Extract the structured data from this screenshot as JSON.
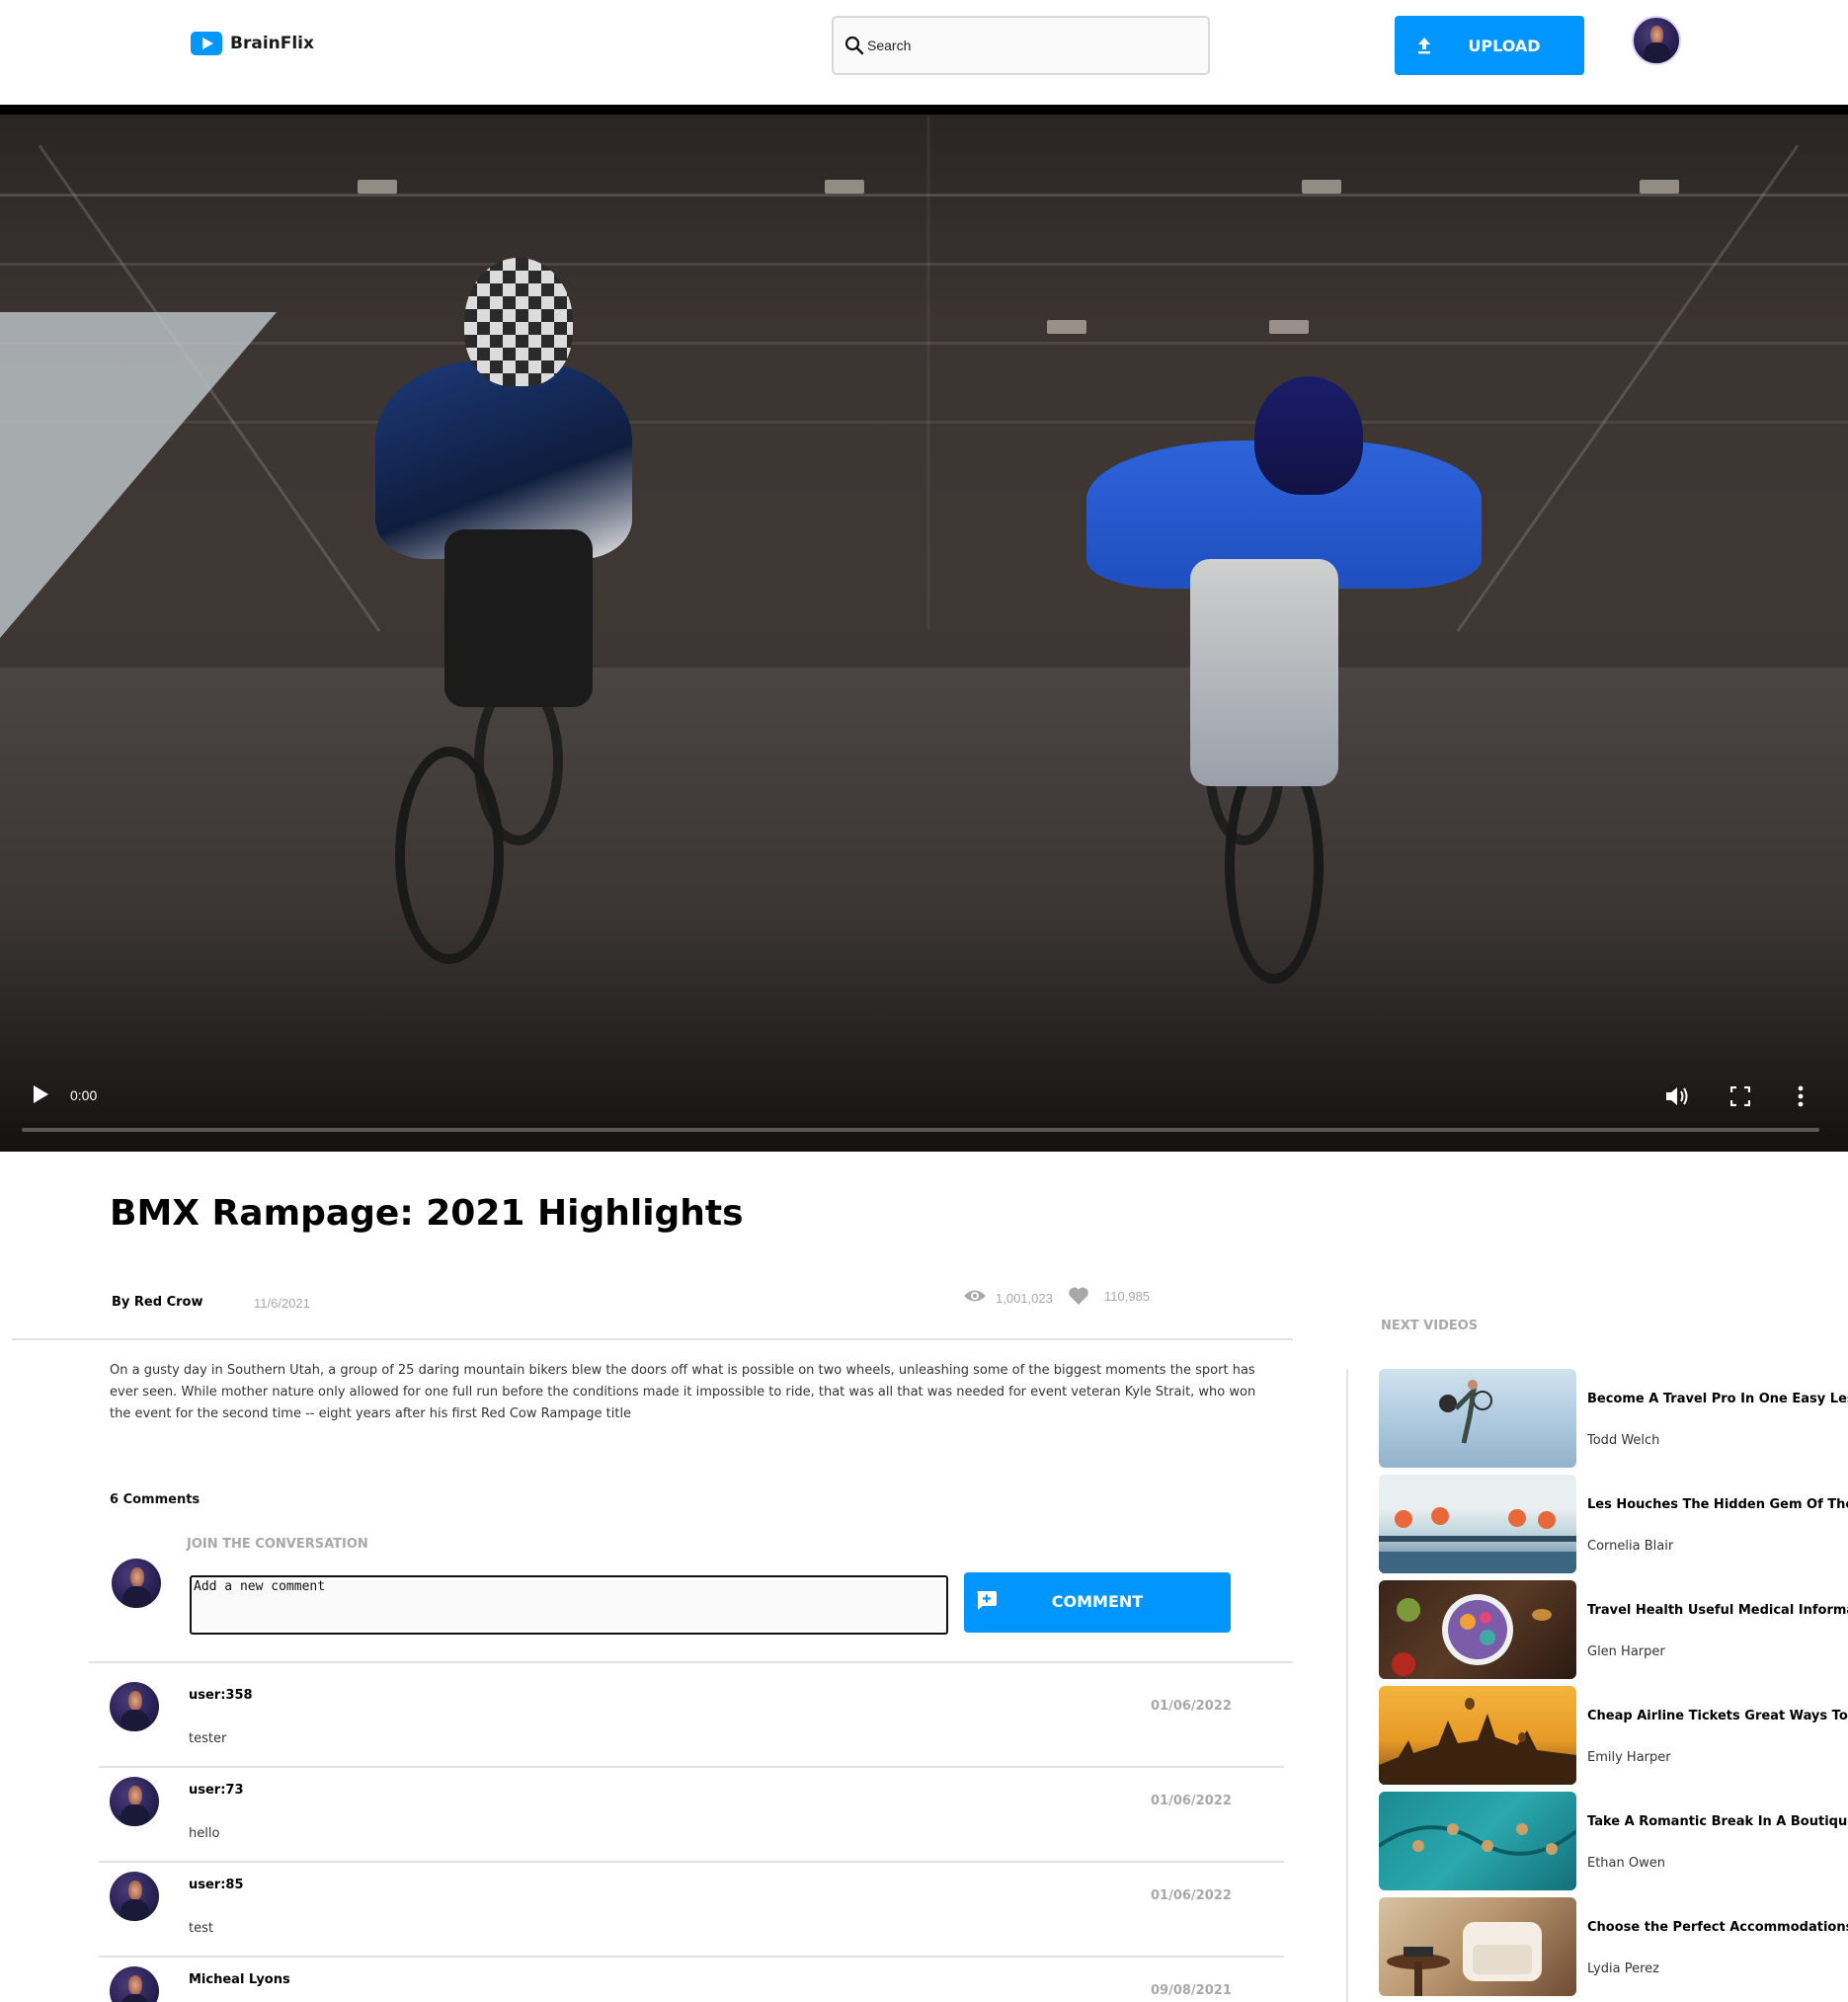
{
  "header": {
    "brand": "BrainFlix",
    "search_placeholder": "Search",
    "upload_label": "UPLOAD"
  },
  "player": {
    "current_time": "0:00",
    "progress": 0
  },
  "video": {
    "title": "BMX Rampage: 2021 Highlights",
    "channel": "By Red Crow",
    "date": "11/6/2021",
    "views": "1,001,023",
    "likes": "110,985",
    "description": "On a gusty day in Southern Utah, a group of 25 daring mountain bikers blew the doors off what is possible on two wheels, unleashing some of the biggest moments the sport has ever seen. While mother nature only allowed for one full run before the conditions made it impossible to ride, that was all that was needed for event veteran Kyle Strait, who won the event for the second time -- eight years after his first Red Cow Rampage title"
  },
  "comments": {
    "count_label": "6 Comments",
    "join_label": "JOIN THE CONVERSATION",
    "input_placeholder": "Add a new comment",
    "button_label": "COMMENT",
    "items": [
      {
        "user": "user:358",
        "text": "tester",
        "date": "01/06/2022"
      },
      {
        "user": "user:73",
        "text": "hello",
        "date": "01/06/2022"
      },
      {
        "user": "user:85",
        "text": "test",
        "date": "01/06/2022"
      },
      {
        "user": "Micheal Lyons",
        "text": "",
        "date": "09/08/2021"
      }
    ]
  },
  "sidebar": {
    "heading": "NEXT VIDEOS",
    "items": [
      {
        "title": "Become A Travel Pro In One Easy Lesson",
        "author": "Todd Welch"
      },
      {
        "title": "Les Houches The Hidden Gem Of The Chamonix",
        "author": "Cornelia Blair"
      },
      {
        "title": "Travel Health Useful Medical Information For",
        "author": "Glen Harper"
      },
      {
        "title": "Cheap Airline Tickets Great Ways To Save",
        "author": "Emily Harper"
      },
      {
        "title": "Take A Romantic Break In A Boutique Hotel",
        "author": "Ethan Owen"
      },
      {
        "title": "Choose the Perfect Accommodations",
        "author": "Lydia Perez"
      }
    ]
  },
  "colors": {
    "accent": "#0095ff",
    "muted_text": "#a8a8a8",
    "divider": "#e2e2e2"
  }
}
